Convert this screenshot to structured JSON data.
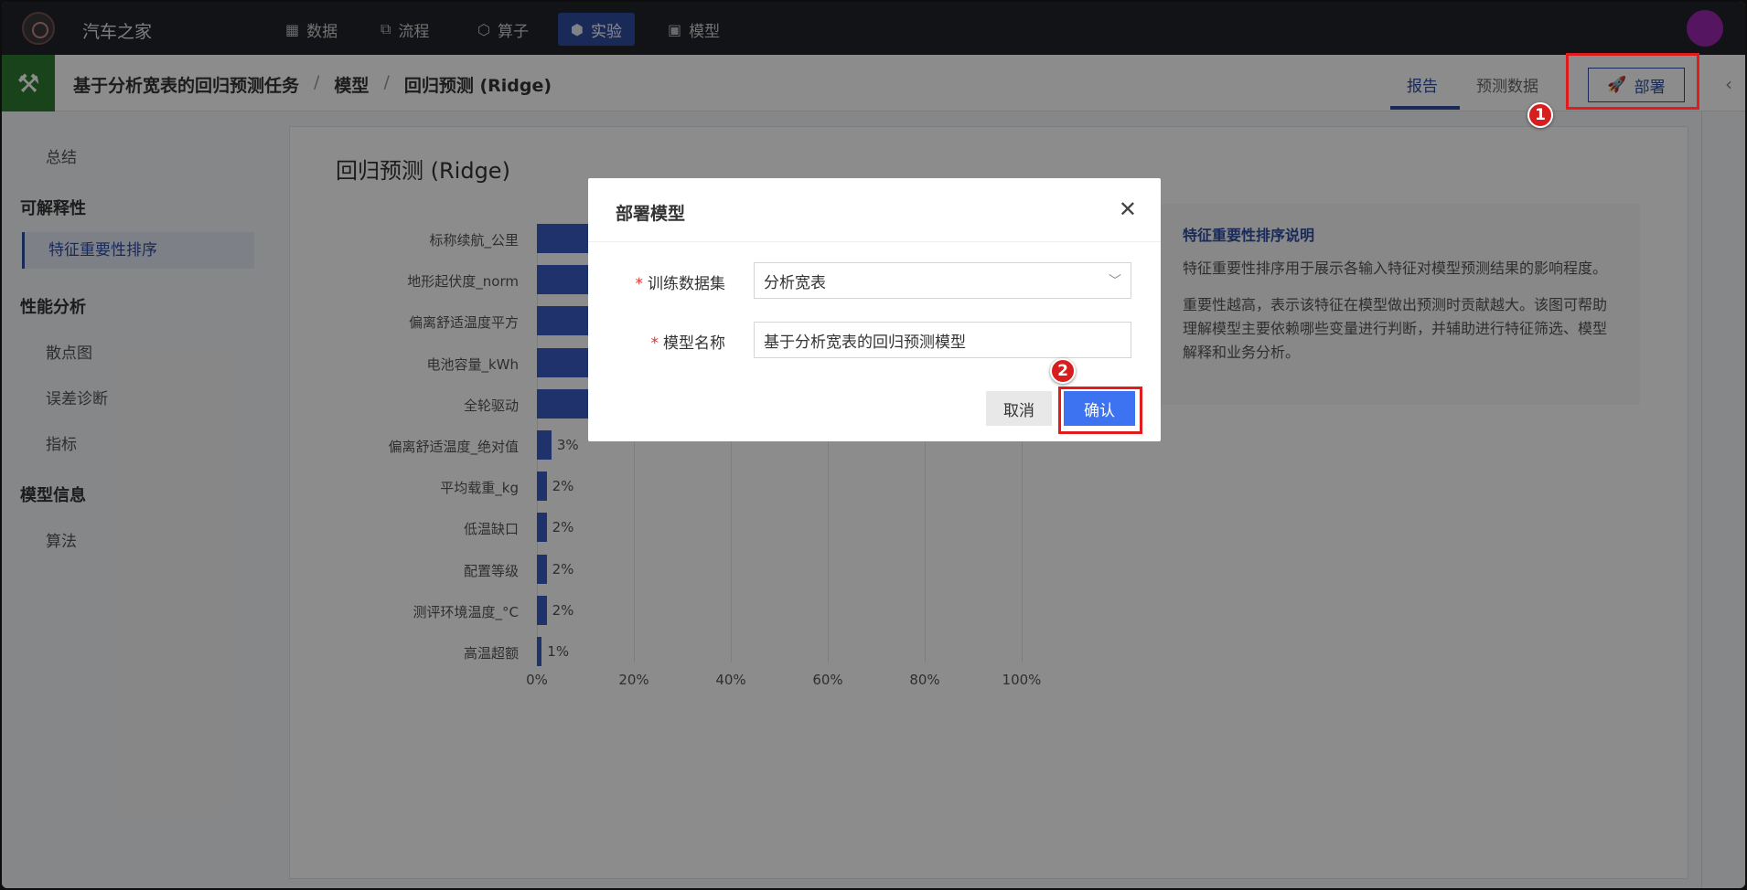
{
  "app": {
    "brand": "汽车之家"
  },
  "nav": [
    {
      "label": "数据",
      "icon": "table-icon"
    },
    {
      "label": "流程",
      "icon": "flow-icon"
    },
    {
      "label": "算子",
      "icon": "operator-icon"
    },
    {
      "label": "实验",
      "icon": "cube-icon"
    },
    {
      "label": "模型",
      "icon": "save-icon"
    }
  ],
  "breadcrumb": [
    "基于分析宽表的回归预测任务",
    "模型",
    "回归预测 (Ridge)"
  ],
  "breadcrumb_sep": "/",
  "tabs": {
    "report": "报告",
    "predict": "预测数据"
  },
  "deploy_label": "部署",
  "sidebar": {
    "summary": "总结",
    "sec1": "可解释性",
    "feature": "特征重要性排序",
    "sec2": "性能分析",
    "scatter": "散点图",
    "error": "误差诊断",
    "metrics": "指标",
    "sec3": "模型信息",
    "algo": "算法"
  },
  "content_title": "回归预测 (Ridge)",
  "chart_data": {
    "type": "bar",
    "orientation": "horizontal",
    "categories": [
      "标称续航_公里",
      "地形起伏度_norm",
      "偏离舒适温度平方",
      "电池容量_kWh",
      "全轮驱动",
      "偏离舒适温度_绝对值",
      "平均载重_kg",
      "低温缺口",
      "配置等级",
      "测评环境温度_°C",
      "高温超额"
    ],
    "values": [
      null,
      null,
      null,
      null,
      null,
      3,
      2,
      2,
      2,
      2,
      1
    ],
    "value_labels": [
      "",
      "",
      "",
      "",
      "",
      "3%",
      "2%",
      "2%",
      "2%",
      "2%",
      "1%"
    ],
    "xticks": [
      "0%",
      "20%",
      "40%",
      "60%",
      "80%",
      "100%"
    ],
    "xlim": [
      0,
      100
    ],
    "color": "#3b5cc4"
  },
  "info": {
    "title": "特征重要性排序说明",
    "p1": "特征重要性排序用于展示各输入特征对模型预测结果的影响程度。",
    "p2": "重要性越高，表示该特征在模型做出预测时贡献越大。该图可帮助理解模型主要依赖哪些变量进行判断，并辅助进行特征筛选、模型解释和业务分析。"
  },
  "modal": {
    "title": "部署模型",
    "req": "*",
    "dataset_label": "训练数据集",
    "dataset_value": "分析宽表",
    "name_label": "模型名称",
    "name_value": "基于分析宽表的回归预测模型",
    "cancel": "取消",
    "confirm": "确认"
  },
  "badges": [
    "1",
    "2"
  ],
  "colors": {
    "primary": "#2f4ea3",
    "confirm": "#3d73f0",
    "highlight": "#e01c1c",
    "brand_green": "#2e7d32"
  }
}
